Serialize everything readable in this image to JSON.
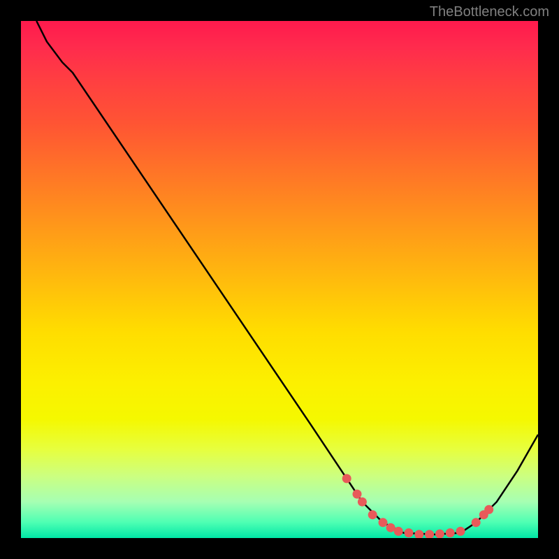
{
  "watermark": "TheBottleneck.com",
  "chart_data": {
    "type": "line",
    "title": "",
    "xlabel": "",
    "ylabel": "",
    "xlim": [
      0,
      100
    ],
    "ylim": [
      0,
      100
    ],
    "curve_points": [
      {
        "x": 3,
        "y": 100
      },
      {
        "x": 5,
        "y": 96
      },
      {
        "x": 8,
        "y": 92
      },
      {
        "x": 10,
        "y": 90
      },
      {
        "x": 56,
        "y": 22
      },
      {
        "x": 62,
        "y": 13
      },
      {
        "x": 66,
        "y": 7
      },
      {
        "x": 70,
        "y": 3
      },
      {
        "x": 74,
        "y": 1
      },
      {
        "x": 80,
        "y": 0.7
      },
      {
        "x": 85,
        "y": 1
      },
      {
        "x": 88,
        "y": 3
      },
      {
        "x": 92,
        "y": 7
      },
      {
        "x": 96,
        "y": 13
      },
      {
        "x": 100,
        "y": 20
      }
    ],
    "scatter_points": [
      {
        "x": 63,
        "y": 11.5
      },
      {
        "x": 65,
        "y": 8.5
      },
      {
        "x": 66,
        "y": 7
      },
      {
        "x": 68,
        "y": 4.5
      },
      {
        "x": 70,
        "y": 3
      },
      {
        "x": 71.5,
        "y": 2
      },
      {
        "x": 73,
        "y": 1.3
      },
      {
        "x": 75,
        "y": 1
      },
      {
        "x": 77,
        "y": 0.7
      },
      {
        "x": 79,
        "y": 0.7
      },
      {
        "x": 81,
        "y": 0.8
      },
      {
        "x": 83,
        "y": 1
      },
      {
        "x": 85,
        "y": 1.3
      },
      {
        "x": 88,
        "y": 3
      },
      {
        "x": 89.5,
        "y": 4.5
      },
      {
        "x": 90.5,
        "y": 5.5
      }
    ],
    "colors": {
      "curve": "#000000",
      "points": "#e85a5a"
    }
  }
}
